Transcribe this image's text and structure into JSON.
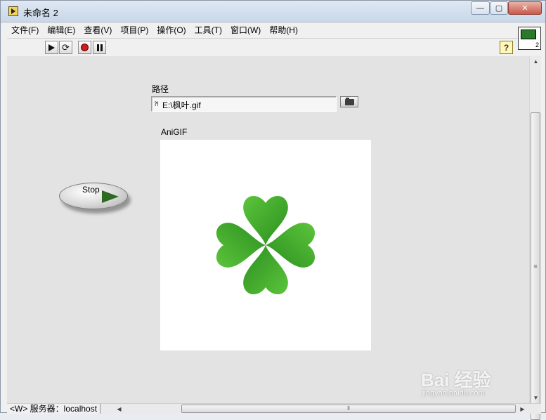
{
  "window": {
    "title": "未命名 2",
    "controls": {
      "minimize": "—",
      "maximize": "▢",
      "close": "✕"
    }
  },
  "menubar": {
    "items": [
      {
        "label": "文件(F)"
      },
      {
        "label": "编辑(E)"
      },
      {
        "label": "查看(V)"
      },
      {
        "label": "项目(P)"
      },
      {
        "label": "操作(O)"
      },
      {
        "label": "工具(T)"
      },
      {
        "label": "窗口(W)"
      },
      {
        "label": "帮助(H)"
      }
    ]
  },
  "toolbar": {
    "help_label": "?",
    "vi_icon_number": "2",
    "icons": [
      "run-arrow-icon",
      "run-continuously-icon",
      "abort-icon",
      "pause-icon",
      "help-icon"
    ]
  },
  "panel": {
    "path_label": "路径",
    "path_value": "E:\\枫叶.gif",
    "path_type_glyph": "⁈",
    "anigif_label": "AniGIF",
    "stop_label": "Stop"
  },
  "statusbar": {
    "context": "<W> 服务器：localhost"
  },
  "watermark": {
    "brand": "Bai 经验",
    "url": "jingyan.baidu.com"
  },
  "colors": {
    "panel_bg": "#e3e3e3",
    "clover_green": "#3aa52b",
    "stop_arrow": "#2f6a24"
  }
}
